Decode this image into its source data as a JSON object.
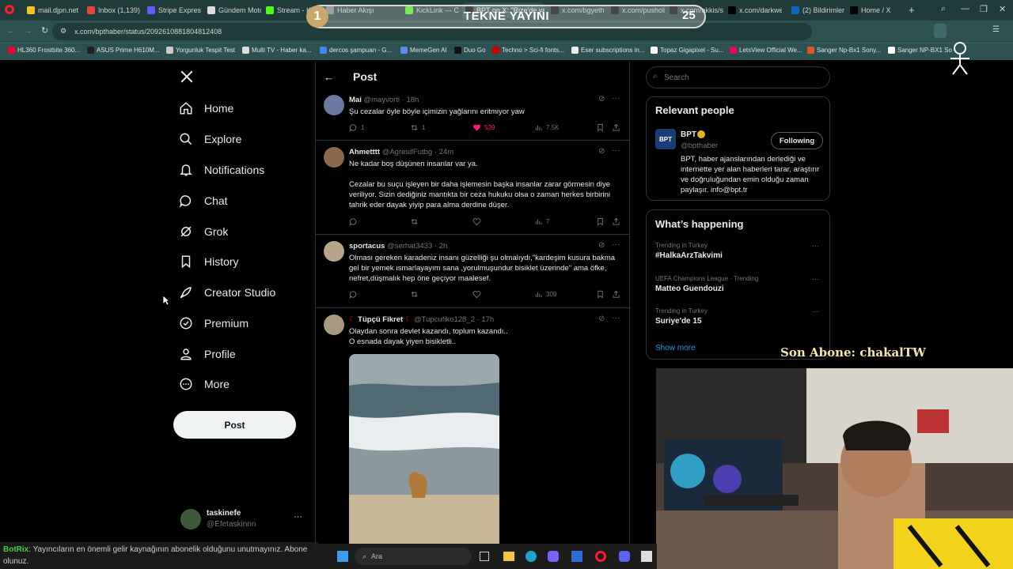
{
  "browser": {
    "tabs": [
      "mail.djpn.net",
      "Inbox (1,139)",
      "Stripe Express",
      "Gündem Motor",
      "Stream - Kick",
      "Haber Akışı",
      "KickLink — Ch",
      "BPT on X: \"Rize'de yaşan",
      "x.com/bgyethe",
      "x.com/pusholid",
      "x.com/akkis/st",
      "x.com/darkwebi",
      "(2) Bildirimler |",
      "Home / X"
    ],
    "url": "x.com/bpthaber/status/2092610881804812408",
    "bookmarks": [
      "HL360 Frostbite 360...",
      "ASUS Prime H610M...",
      "Yorgunluk Tespit Test",
      "Multi TV - Haber ka...",
      "dercos şampuan - G...",
      "MemeGen AI",
      "Duo Go",
      "Techno > Sci-fi fonts...",
      "Eser subscriptions in...",
      "Topaz Gigapixel - Su...",
      "LetsView Official We...",
      "Sanger Np-Bx1 Sony...",
      "Sanger NP-BX1 So"
    ]
  },
  "overlay": {
    "left_num": "1",
    "title": "TEKNE YAYINI",
    "right_num": "25"
  },
  "sidebar": {
    "items": [
      "Home",
      "Explore",
      "Notifications",
      "Chat",
      "Grok",
      "History",
      "Creator Studio",
      "Premium",
      "Profile",
      "More"
    ],
    "post_label": "Post",
    "user_name": "taskinefe",
    "user_handle": "@Efetaskinnn"
  },
  "center": {
    "title": "Post",
    "tweets": [
      {
        "name": "Mai",
        "handle": "@mayvorti",
        "time": "· 18h",
        "text": "Şu cezalar öyle böyle içimizin yağlarını eritmiyor yaw",
        "replies": "1",
        "reposts": "1",
        "likes": "539",
        "views": "7.5K"
      },
      {
        "name": "Ahmetttt",
        "handle": "@AgresifFutbg",
        "time": "· 24m",
        "text1": "Ne kadar boş düşünen insanlar var ya.",
        "text2": "Cezalar bu suçu işleyen bir daha işlemesin başka insanlar zarar görmesin diye veriliyor. Sizin dediğiniz mantıkta bir ceza hukuku olsa o zaman herkes birbirini tahrik eder dayak yiyip para alma derdine düşer.",
        "views": "7"
      },
      {
        "name": "sportacus",
        "handle": "@serhat3433",
        "time": "· 2h",
        "text": "Olması gereken karadeniz insanı güzelliği şu olmalıydı,\"kardeşim kusura bakma gel bir yemek ısmarlayayım sana ,yorulmuşundur bisiklet üzerinde\" ama öfke, nefret,düşmalık hep öne geçiyor maalesef.",
        "views": "309"
      },
      {
        "name": "Tüpçü Fikret",
        "handle": "@Tupcufiko128_2",
        "time": "· 17h",
        "text1": "Olaydan sonra devlet kazandı, toplum kazandı..",
        "text2": "O esnada dayak yiyen bisikletli.."
      }
    ]
  },
  "right": {
    "search_placeholder": "Search",
    "relevant_title": "Relevant people",
    "person_name": "BPT",
    "person_handle": "@bpthaber",
    "following_label": "Following",
    "person_bio": "BPT, haber ajanslarından derlediği ve internette yer alan haberleri tarar, araştırır ve doğruluğundan emin olduğu zaman paylaşır. info@bpt.tr",
    "happening_title": "What’s happening",
    "trends": [
      {
        "meta": "Trending in Turkey",
        "name": "#HalkaArzTakvimi"
      },
      {
        "meta": "UEFA Champions League · Trending",
        "name": "Matteo Guendouzi"
      },
      {
        "meta": "Trending in Turkey",
        "name": "Suriye'de 15"
      }
    ],
    "show_more": "Show more"
  },
  "stream": {
    "son_abone": "Son Abone: chakalTW",
    "chat_text": ": Yayıncıların en önemli gelir kaynağının abonelik olduğunu unutmayınız. Abone olunuz.",
    "chat_user": "BotRix",
    "taskbar_search": "Ara"
  },
  "colors": {
    "accent": "#1d9bf0",
    "like": "#f91880",
    "browser": "#2d5150"
  }
}
